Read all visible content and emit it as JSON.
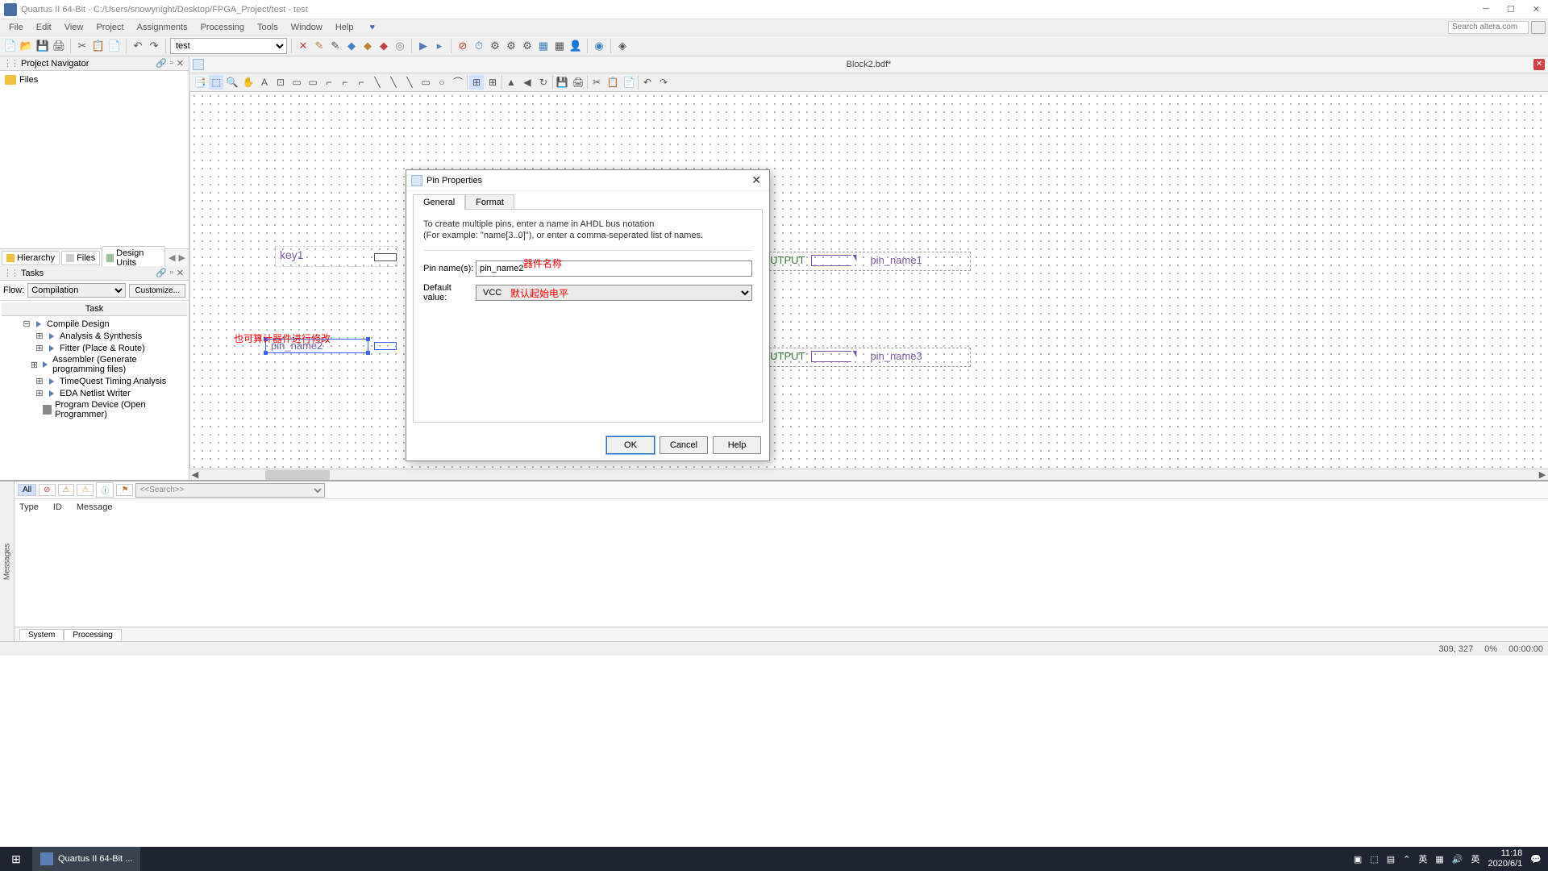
{
  "titlebar": {
    "title": "Quartus II 64-Bit - C:/Users/snowynight/Desktop/FPGA_Project/test - test"
  },
  "menubar": {
    "items": [
      "File",
      "Edit",
      "View",
      "Project",
      "Assignments",
      "Processing",
      "Tools",
      "Window",
      "Help"
    ],
    "search_placeholder": "Search altera.com"
  },
  "toolbar": {
    "project_selector": "test"
  },
  "project_navigator": {
    "title": "Project Navigator",
    "root": "Files",
    "tabs": {
      "hierarchy": "Hierarchy",
      "files": "Files",
      "designunits": "Design Units"
    }
  },
  "tasks": {
    "title": "Tasks",
    "flow_label": "Flow:",
    "flow_value": "Compilation",
    "customize": "Customize...",
    "header": "Task",
    "items": [
      {
        "label": "Compile Design",
        "indent": 0,
        "expandable": true,
        "expanded": true,
        "icon": "play"
      },
      {
        "label": "Analysis & Synthesis",
        "indent": 1,
        "expandable": true,
        "expanded": false,
        "icon": "play"
      },
      {
        "label": "Fitter (Place & Route)",
        "indent": 1,
        "expandable": true,
        "expanded": false,
        "icon": "play"
      },
      {
        "label": "Assembler (Generate programming files)",
        "indent": 1,
        "expandable": true,
        "expanded": false,
        "icon": "play"
      },
      {
        "label": "TimeQuest Timing Analysis",
        "indent": 1,
        "expandable": true,
        "expanded": false,
        "icon": "play"
      },
      {
        "label": "EDA Netlist Writer",
        "indent": 1,
        "expandable": true,
        "expanded": false,
        "icon": "play"
      },
      {
        "label": "Program Device (Open Programmer)",
        "indent": 1,
        "expandable": false,
        "icon": "chip"
      }
    ]
  },
  "document": {
    "title": "Block2.bdf*"
  },
  "canvas": {
    "key1": "key1",
    "pin_name2": "pin_name2",
    "output_label": "OUTPUT",
    "pin_name1": "pin_name1",
    "pin_name3": "pin_name3",
    "annotation_input": "也可算计器件进行修改",
    "annotation_pinname": "器件名称",
    "annotation_default": "默认起始电平"
  },
  "messages": {
    "vtab": "Messages",
    "filter_all": "All",
    "search_placeholder": "<<Search>>",
    "columns": {
      "type": "Type",
      "id": "ID",
      "message": "Message"
    },
    "tabs": {
      "system": "System",
      "processing": "Processing"
    }
  },
  "statusbar": {
    "coords": "309, 327",
    "zoom": "0%",
    "time": "00:00:00"
  },
  "taskbar": {
    "app": "Quartus II 64-Bit ...",
    "ime": "英",
    "ime2": "英",
    "time": "11:18",
    "date": "2020/6/1"
  },
  "dialog": {
    "title": "Pin Properties",
    "tabs": {
      "general": "General",
      "format": "Format"
    },
    "help_text1": "To create multiple pins, enter a name in AHDL bus notation",
    "help_text2": "(For example: \"name[3..0]\"), or enter a comma-seperated list of names.",
    "pin_name_label": "Pin name(s):",
    "pin_name_value": "pin_name2",
    "default_value_label": "Default value:",
    "default_value_value": "VCC",
    "buttons": {
      "ok": "OK",
      "cancel": "Cancel",
      "help": "Help"
    }
  }
}
